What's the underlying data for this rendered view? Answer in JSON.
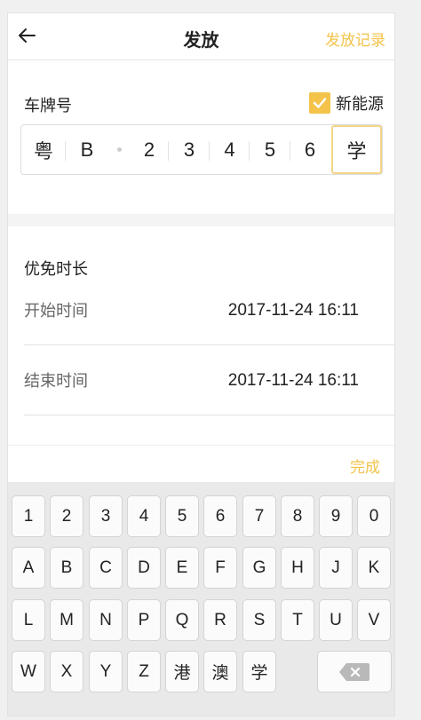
{
  "header": {
    "title": "发放",
    "record_link": "发放记录"
  },
  "plate": {
    "label": "车牌号",
    "new_energy_label": "新能源",
    "chars": [
      "粤",
      "B",
      "2",
      "3",
      "4",
      "5",
      "6",
      "学"
    ]
  },
  "duration": {
    "title": "优免时长",
    "start_label": "开始时间",
    "start_value": "2017-11-24 16:11",
    "end_label": "结束时间",
    "end_value": "2017-11-24 16:11"
  },
  "keyboard": {
    "done_label": "完成",
    "rows": [
      [
        "1",
        "2",
        "3",
        "4",
        "5",
        "6",
        "7",
        "8",
        "9",
        "0"
      ],
      [
        "A",
        "B",
        "C",
        "D",
        "E",
        "F",
        "G",
        "H",
        "J",
        "K"
      ],
      [
        "L",
        "M",
        "N",
        "P",
        "Q",
        "R",
        "S",
        "T",
        "U",
        "V"
      ],
      [
        "W",
        "X",
        "Y",
        "Z",
        "港",
        "澳",
        "学"
      ]
    ]
  },
  "colors": {
    "accent": "#f3c34a"
  }
}
